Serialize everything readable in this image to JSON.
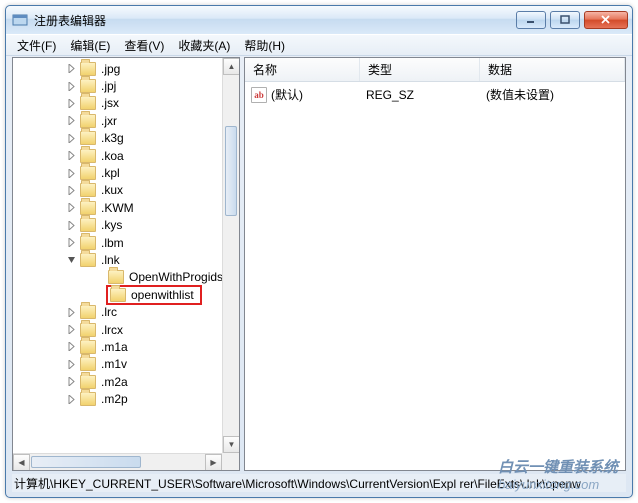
{
  "window": {
    "title": "注册表编辑器"
  },
  "menu": {
    "file": "文件(F)",
    "edit": "编辑(E)",
    "view": "查看(V)",
    "favorites": "收藏夹(A)",
    "help": "帮助(H)"
  },
  "tree": {
    "items": [
      ".jpg",
      ".jpj",
      ".jsx",
      ".jxr",
      ".k3g",
      ".koa",
      ".kpl",
      ".kux",
      ".KWM",
      ".kys",
      ".lbm",
      ".lnk",
      "OpenWithProgids",
      "openwithlist",
      ".lrc",
      ".lrcx",
      ".m1a",
      ".m1v",
      ".m2a",
      ".m2p"
    ]
  },
  "list": {
    "head": {
      "name": "名称",
      "type": "类型",
      "data": "数据"
    },
    "row": {
      "icon": "ab",
      "name": "(默认)",
      "type": "REG_SZ",
      "data": "(数值未设置)"
    }
  },
  "status": {
    "path": "计算机\\HKEY_CURRENT_USER\\Software\\Microsoft\\Windows\\CurrentVersion\\Expl rer\\FileExts\\.lnk\\openw"
  },
  "watermark": {
    "line1": "白云一键重装系统",
    "line2": "baiyunxitong.com"
  }
}
